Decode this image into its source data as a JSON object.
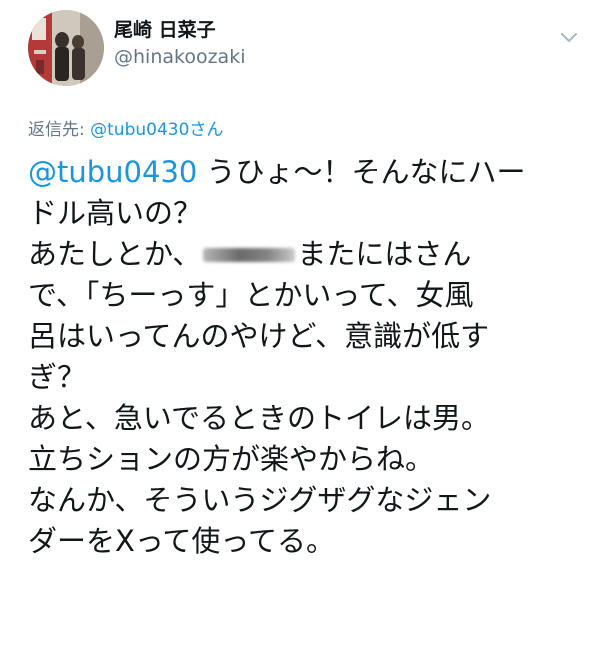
{
  "header": {
    "display_name": "尾崎 日菜子",
    "handle": "@hinakoozaki"
  },
  "reply": {
    "prefix": "返信先: ",
    "mention": "@tubu0430さん"
  },
  "body": {
    "mention": "@tubu0430",
    "line1_rest": " うひょ〜！そんなにハー",
    "line2": "ドル高いの？",
    "line3_start": "あたしとか、",
    "line3_end": "またにはさん",
    "line4": "で、「ちーっす」とかいって、女風",
    "line5": "呂はいってんのやけど、意識が低す",
    "line6": "ぎ？",
    "line7": "あと、急いでるときのトイレは男。",
    "line8": "立ちションの方が楽やからね。",
    "line9": "なんか、そういうジグザグなジェン",
    "line10": "ダーをXって使ってる。"
  },
  "icons": {
    "menu": "chevron-down-icon",
    "avatar": "profile-photo"
  },
  "colors": {
    "link": "#1b95e0",
    "secondary": "#657786",
    "text": "#14171a"
  }
}
